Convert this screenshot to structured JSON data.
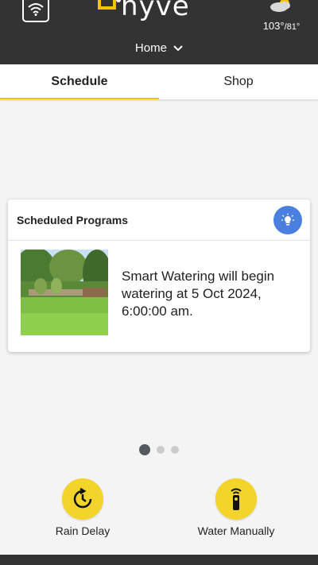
{
  "app": {
    "logo": "b·hyve",
    "location": "Home"
  },
  "weather": {
    "icon": "partly-cloudy-icon",
    "high": "103°",
    "low": "/81°"
  },
  "tabs": [
    {
      "label": "Schedule",
      "active": true
    },
    {
      "label": "Shop",
      "active": false
    }
  ],
  "card": {
    "title": "Scheduled Programs",
    "program_text": "Smart Watering will begin watering at 5 Oct 2024, 6:00:00 am."
  },
  "pagination": {
    "pages": 3,
    "current": 1
  },
  "actions": {
    "rain_delay": "Rain Delay",
    "water_manually": "Water Manually"
  },
  "colors": {
    "accent": "#f3d42a",
    "header": "#333333",
    "info_button": "#4a7fe0"
  }
}
